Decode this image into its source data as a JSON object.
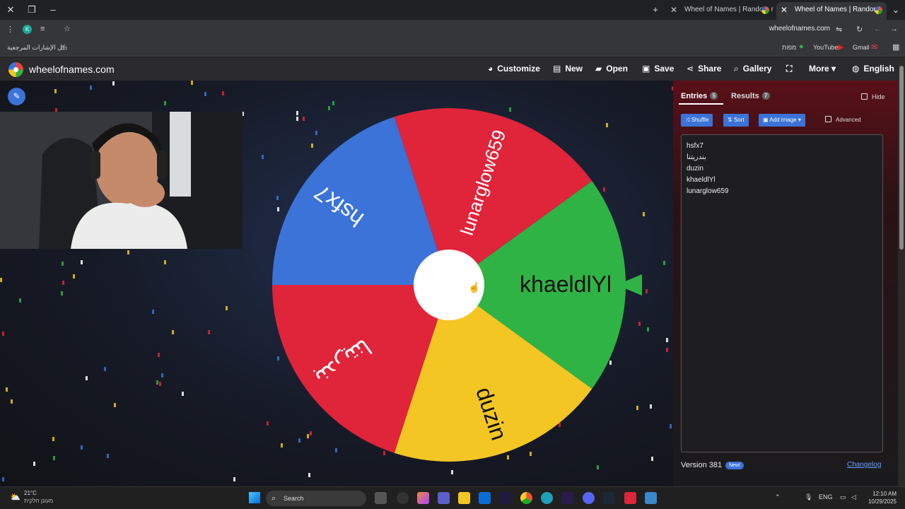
{
  "browser": {
    "tabs": [
      {
        "title": "Wheel of Names | Random nam",
        "active": false
      },
      {
        "title": "Wheel of Names | Random",
        "active": true
      }
    ],
    "url": "wheelofnames.com",
    "bookmarks": {
      "all_bookmarks": "كل الإشارات المرجعية",
      "maps": "מפות",
      "youtube": "YouTube",
      "gmail": "Gmail"
    }
  },
  "site": {
    "name": "wheelofnames.com",
    "nav": {
      "customize": "Customize",
      "new": "New",
      "open": "Open",
      "save": "Save",
      "share": "Share",
      "gallery": "Gallery",
      "more": "More",
      "language": "English"
    }
  },
  "wheel": {
    "slices": [
      {
        "label": "khaeldlYl",
        "color": "#2fb344"
      },
      {
        "label": "duzin",
        "color": "#f3c623"
      },
      {
        "label": "بندريتنا",
        "color": "#e0243a"
      },
      {
        "label": "hsfx7",
        "color": "#3b73d8"
      },
      {
        "label": "lunarglow659",
        "color": "#e0243a"
      }
    ]
  },
  "panel": {
    "tabs": {
      "entries": "Entries",
      "entries_count": "5",
      "results": "Results",
      "results_count": "7"
    },
    "hide": "Hide",
    "buttons": {
      "shuffle": "Shuffle",
      "sort": "Sort",
      "add_image": "Add image"
    },
    "advanced": "Advanced",
    "entries": [
      "hsfx7",
      "بندريتنا",
      "duzin",
      "khaeldlYl",
      "lunarglow659"
    ],
    "version": "Version 381",
    "new_badge": "New!",
    "changelog": "Changelog"
  },
  "taskbar": {
    "temperature": "21°C",
    "condition": "מעונן חלקית",
    "search": "Search",
    "lang": "ENG",
    "time": "12:10 AM",
    "date": "10/29/2025"
  }
}
